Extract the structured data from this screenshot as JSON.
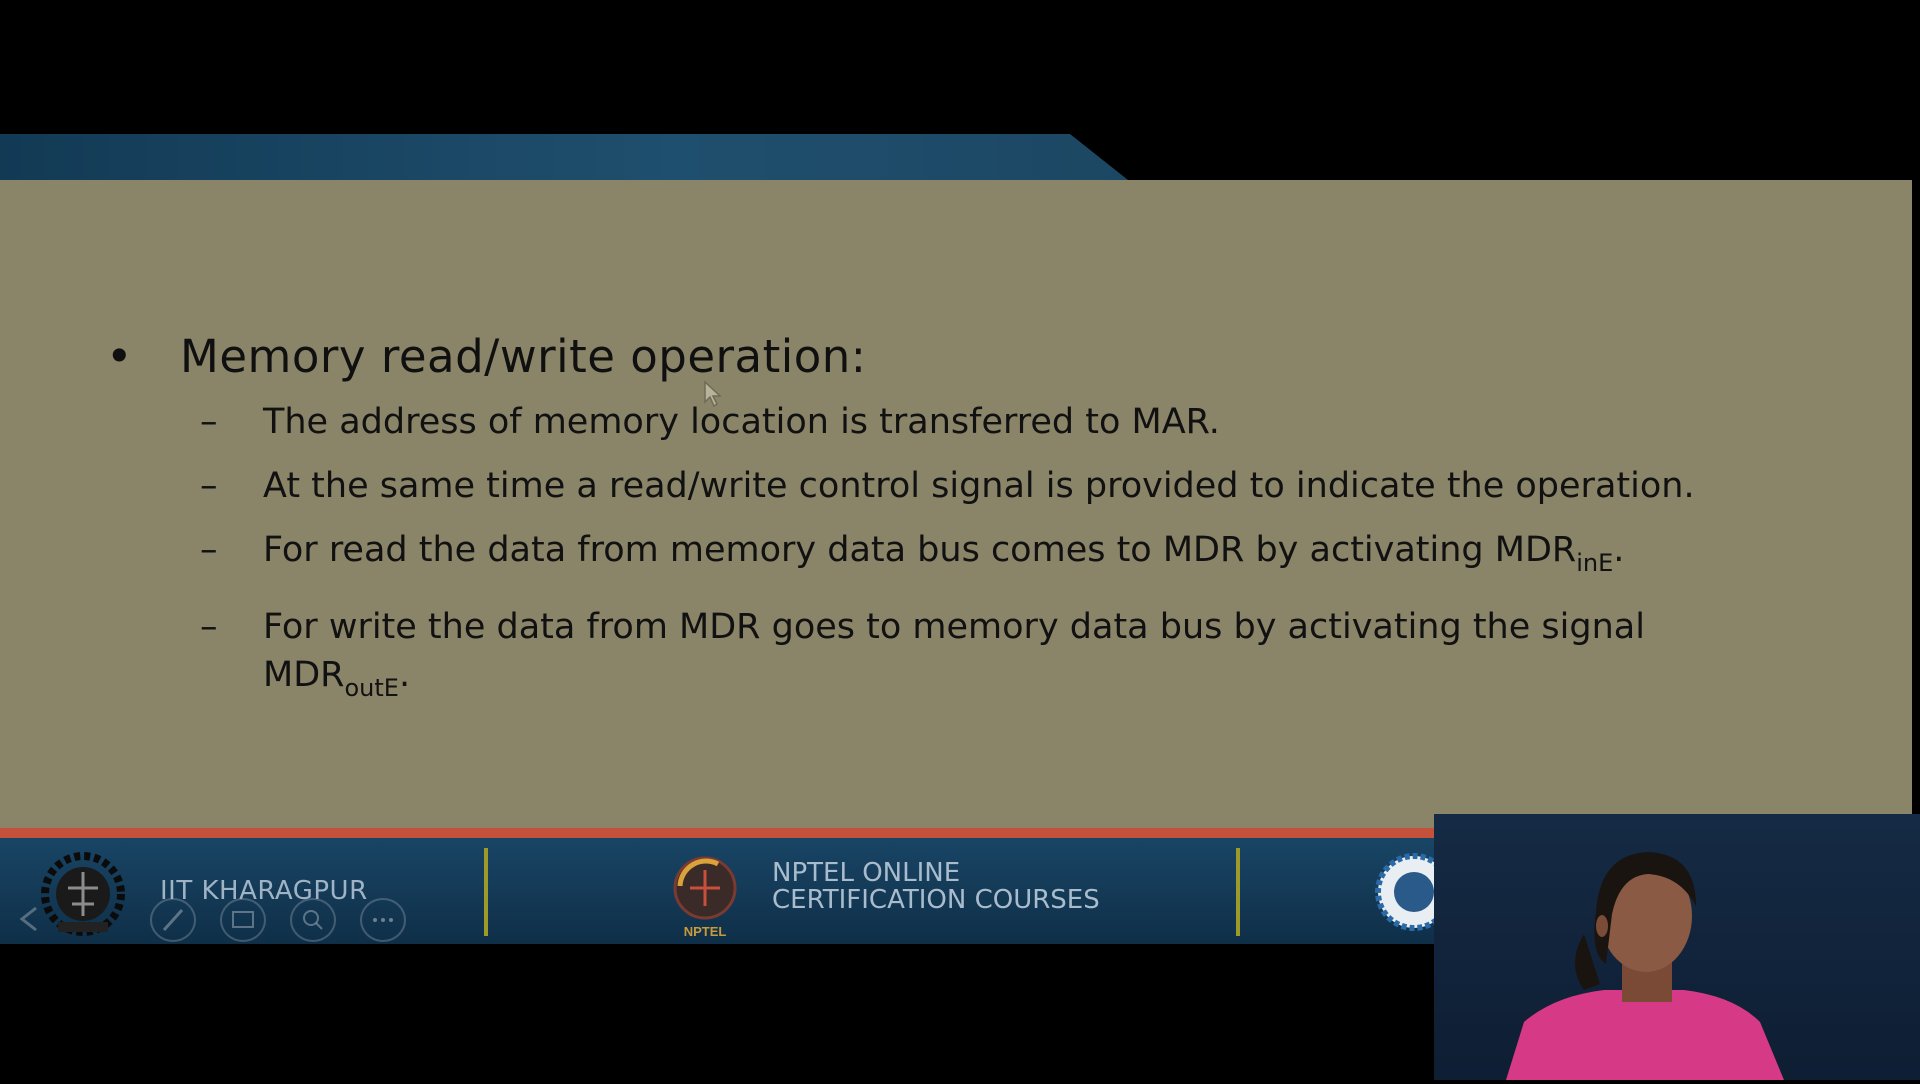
{
  "slide": {
    "bullet": "Memory read/write operation:",
    "dash": "–",
    "items": [
      {
        "text": "The address of memory location is transferred to MAR."
      },
      {
        "text": "At the same time a read/write control signal is provided to indicate the operation."
      },
      {
        "text": "For read the data from memory data bus comes to MDR by activating MDR",
        "sub": "inE",
        "tail": "."
      },
      {
        "text": "For write the data from MDR goes to memory data bus by activating the signal MDR",
        "sub": "outE",
        "tail": "."
      }
    ]
  },
  "footer": {
    "institute": "IIT KHARAGPUR",
    "nptel_line1": "NPTEL ONLINE",
    "nptel_line2": "CERTIFICATION COURSES",
    "nptel_logo_text": "NPTEL"
  },
  "player_controls": [
    "prev-icon",
    "pen-icon",
    "slides-icon",
    "zoom-icon",
    "more-icon"
  ],
  "colors": {
    "slide_bg": "#8a8468",
    "footer_bg": "#1a4768",
    "accent_red": "#c4513a",
    "webcam_bg": "#152a44",
    "presenter_top": "#d63a86"
  }
}
